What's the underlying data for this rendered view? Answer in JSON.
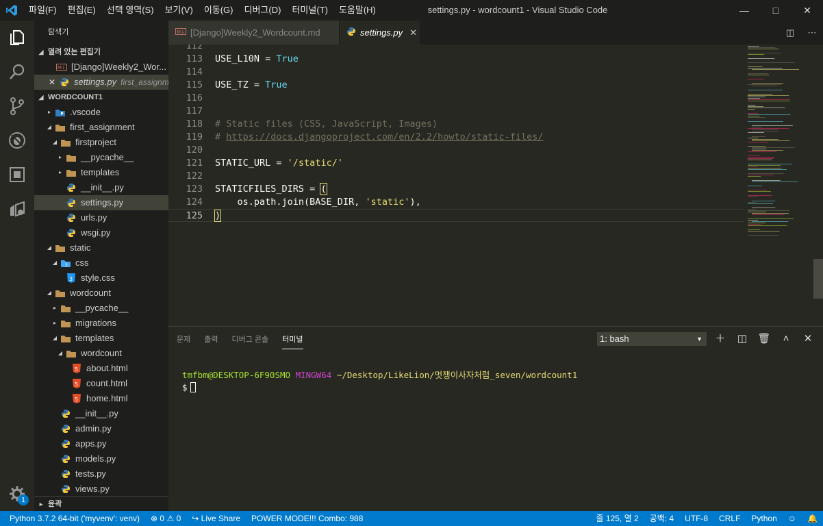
{
  "titlebar": {
    "menu": [
      "파일(F)",
      "편집(E)",
      "선택 영역(S)",
      "보기(V)",
      "이동(G)",
      "디버그(D)",
      "터미널(T)",
      "도움말(H)"
    ],
    "title": "settings.py - wordcount1 - Visual Studio Code"
  },
  "activity": {
    "badge": "1"
  },
  "sidebar": {
    "title": "탐색기",
    "open_editors_label": "열려 있는 편집기",
    "open_editors": [
      {
        "name": "[Django]Weekly2_Wor...",
        "desc": ""
      },
      {
        "name": "settings.py",
        "desc": "first_assignm..."
      }
    ],
    "workspace_label": "WORDCOUNT1",
    "tree": [
      {
        "name": ".vscode"
      },
      {
        "name": "first_assignment"
      },
      {
        "name": "firstproject"
      },
      {
        "name": "__pycache__"
      },
      {
        "name": "templates"
      },
      {
        "name": "__init__.py"
      },
      {
        "name": "settings.py"
      },
      {
        "name": "urls.py"
      },
      {
        "name": "wsgi.py"
      },
      {
        "name": "static"
      },
      {
        "name": "css"
      },
      {
        "name": "style.css"
      },
      {
        "name": "wordcount"
      },
      {
        "name": "__pycache__"
      },
      {
        "name": "migrations"
      },
      {
        "name": "templates"
      },
      {
        "name": "wordcount"
      },
      {
        "name": "about.html"
      },
      {
        "name": "count.html"
      },
      {
        "name": "home.html"
      },
      {
        "name": "__init__.py"
      },
      {
        "name": "admin.py"
      },
      {
        "name": "apps.py"
      },
      {
        "name": "models.py"
      },
      {
        "name": "tests.py"
      },
      {
        "name": "views.py"
      }
    ],
    "outline_label": "윤곽"
  },
  "tabs": [
    {
      "label": "[Django]Weekly2_Wordcount.md"
    },
    {
      "label": "settings.py"
    }
  ],
  "code": {
    "lines": [
      {
        "n": "112",
        "parts": []
      },
      {
        "n": "113",
        "parts": [
          [
            "USE_L10N = ",
            ""
          ],
          [
            "True",
            "kw"
          ]
        ]
      },
      {
        "n": "114",
        "parts": []
      },
      {
        "n": "115",
        "parts": [
          [
            "USE_TZ = ",
            ""
          ],
          [
            "True",
            "kw"
          ]
        ]
      },
      {
        "n": "116",
        "parts": []
      },
      {
        "n": "117",
        "parts": []
      },
      {
        "n": "118",
        "parts": [
          [
            "# Static files (CSS, JavaScript, Images)",
            "cm"
          ]
        ]
      },
      {
        "n": "119",
        "parts": [
          [
            "# ",
            "cm"
          ],
          [
            "https://docs.djangoproject.com/en/2.2/howto/static-files/",
            "cmurl"
          ]
        ]
      },
      {
        "n": "120",
        "parts": []
      },
      {
        "n": "121",
        "parts": [
          [
            "STATIC_URL = ",
            ""
          ],
          [
            "'/static/'",
            "str"
          ]
        ]
      },
      {
        "n": "122",
        "parts": []
      },
      {
        "n": "123",
        "parts": [
          [
            "STATICFILES_DIRS = ",
            ""
          ],
          [
            "(",
            "bracket"
          ]
        ]
      },
      {
        "n": "124",
        "parts": [
          [
            "    os.path.join(BASE_DIR, ",
            ""
          ],
          [
            "'static'",
            "str"
          ],
          [
            "),",
            ""
          ]
        ]
      },
      {
        "n": "125",
        "parts": [
          [
            ")",
            "bracket"
          ]
        ]
      }
    ]
  },
  "panel": {
    "tabs": [
      "문제",
      "출력",
      "디버그 콘솔",
      "터미널"
    ],
    "terminal_select": "1: bash",
    "term_user": "tmfbm@DESKTOP-6F90SMO",
    "term_env": "MINGW64",
    "term_path": "~/Desktop/LikeLion/멋쟁이사자처럼_seven/wordcount1",
    "term_prompt": "$"
  },
  "status": {
    "python": "Python 3.7.2 64-bit ('myvenv': venv)",
    "errors": "0",
    "warnings": "0",
    "liveshare": "Live Share",
    "powermode": "POWER MODE!!! Combo: 988",
    "position": "줄 125, 열 2",
    "spaces": "공백: 4",
    "encoding": "UTF-8",
    "eol": "CRLF",
    "language": "Python"
  }
}
